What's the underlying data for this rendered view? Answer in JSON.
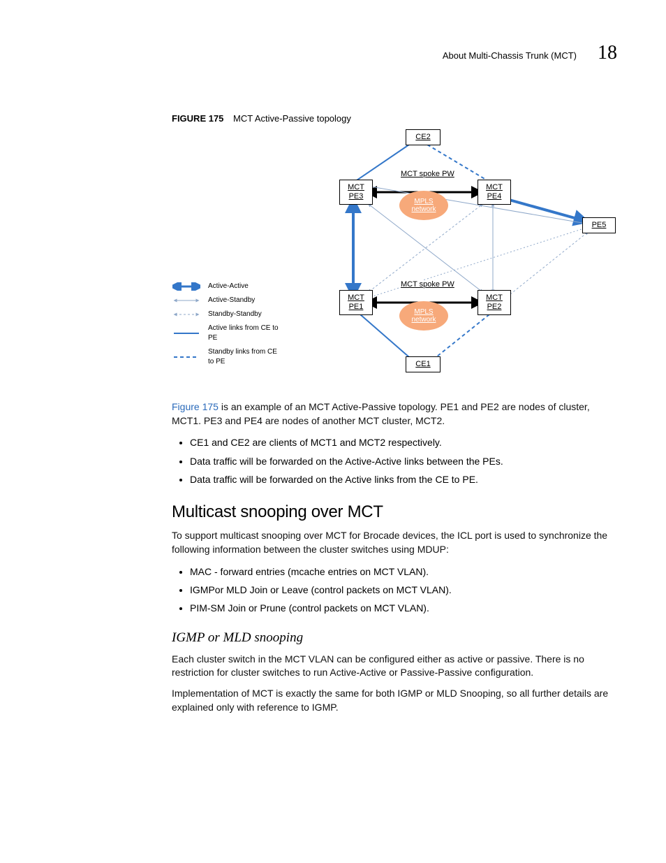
{
  "header": {
    "title": "About Multi-Chassis Trunk (MCT)",
    "pageNumber": "18"
  },
  "figure": {
    "label": "FIGURE 175",
    "caption": "MCT Active-Passive topology"
  },
  "diagram": {
    "nodes": {
      "ce2": "CE2",
      "pe3": "MCT\nPE3",
      "pe4": "MCT\nPE4",
      "pe5": "PE5",
      "pe1": "MCT\nPE1",
      "pe2": "MCT\nPE2",
      "ce1": "CE1",
      "cloud1": "MPLS\nnetwork",
      "cloud2": "MPLS\nnetwork",
      "spoke1": "MCT spoke PW",
      "spoke2": "MCT spoke PW"
    },
    "legend": [
      "Active-Active",
      "Active-Standby",
      "Standby-Standby",
      "Active links from CE to PE",
      "Standby links from CE to PE"
    ]
  },
  "body": {
    "para1_link": "Figure 175",
    "para1_rest": " is an example of an MCT Active-Passive topology. PE1 and PE2 are nodes of cluster, MCT1. PE3 and PE4 are nodes of another MCT cluster, MCT2.",
    "bullets1": [
      "CE1 and CE2 are clients of MCT1 and MCT2 respectively.",
      "Data traffic will be forwarded on the Active-Active links between the PEs.",
      "Data traffic will be forwarded on the Active links from the CE to PE."
    ],
    "h2": "Multicast snooping over MCT",
    "para2": "To support multicast snooping over MCT for Brocade devices, the ICL port is used to synchronize the following information between the cluster switches using MDUP:",
    "bullets2": [
      "MAC - forward entries (mcache entries on MCT VLAN).",
      "IGMPor MLD Join or Leave (control packets on MCT VLAN).",
      "PIM-SM Join or Prune (control packets on MCT VLAN)."
    ],
    "h3": "IGMP or MLD snooping",
    "para3": "Each cluster switch in the MCT VLAN can be configured either as active or passive. There is no restriction for cluster switches to run Active-Active or Passive-Passive configuration.",
    "para4": "Implementation of MCT is exactly the same for both IGMP or MLD Snooping, so all further details are explained only with reference to IGMP."
  }
}
